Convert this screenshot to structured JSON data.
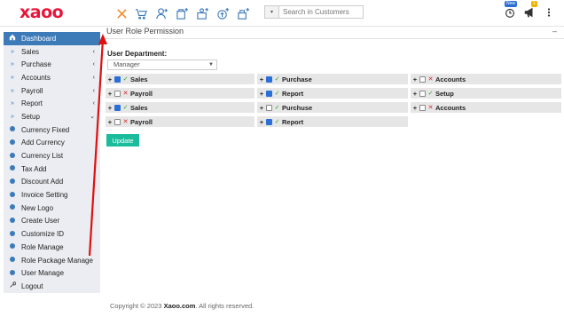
{
  "logo": "xaoo",
  "header": {
    "search_placeholder": "Search in Customers",
    "search_drop": "▾",
    "new_badge": "New",
    "notif_badge": "1"
  },
  "sidebar": {
    "items": [
      {
        "label": "Dashboard",
        "icon": "home-icon",
        "active": true,
        "chev": ""
      },
      {
        "label": "Sales",
        "icon": "double-chevron-icon",
        "chev": "‹"
      },
      {
        "label": "Purchase",
        "icon": "double-chevron-icon",
        "chev": "‹"
      },
      {
        "label": "Accounts",
        "icon": "double-chevron-icon",
        "chev": "‹"
      },
      {
        "label": "Payroll",
        "icon": "double-chevron-icon",
        "chev": "‹"
      },
      {
        "label": "Report",
        "icon": "double-chevron-icon",
        "chev": "‹"
      },
      {
        "label": "Setup",
        "icon": "double-chevron-icon",
        "chev": "⌄"
      },
      {
        "label": "Currency Fixed",
        "icon": "circle-icon",
        "chev": ""
      },
      {
        "label": "Add Currency",
        "icon": "circle-icon",
        "chev": ""
      },
      {
        "label": "Currency List",
        "icon": "circle-icon",
        "chev": ""
      },
      {
        "label": "Tax Add",
        "icon": "circle-icon",
        "chev": ""
      },
      {
        "label": "Discount Add",
        "icon": "circle-icon",
        "chev": ""
      },
      {
        "label": "Invoice Setting",
        "icon": "circle-icon",
        "chev": ""
      },
      {
        "label": "New Logo",
        "icon": "circle-icon",
        "chev": ""
      },
      {
        "label": "Create User",
        "icon": "circle-icon",
        "chev": ""
      },
      {
        "label": "Customize ID",
        "icon": "circle-icon",
        "chev": ""
      },
      {
        "label": "Role Manage",
        "icon": "circle-icon",
        "chev": ""
      },
      {
        "label": "Role Package Manage",
        "icon": "circle-icon",
        "chev": ""
      },
      {
        "label": "User Manage",
        "icon": "circle-icon",
        "chev": ""
      },
      {
        "label": "Logout",
        "icon": "wrench-icon",
        "chev": ""
      }
    ]
  },
  "main": {
    "title": "User Role Permission",
    "minimize": "–",
    "dept_label": "User Department:",
    "dept_value": "Manager",
    "update_label": "Update",
    "permissions": [
      [
        {
          "name": "Sales",
          "checked": true,
          "ok": true
        },
        {
          "name": "Purchase",
          "checked": true,
          "ok": true
        },
        {
          "name": "Accounts",
          "checked": false,
          "ok": false
        }
      ],
      [
        {
          "name": "Payroll",
          "checked": false,
          "ok": false
        },
        {
          "name": "Report",
          "checked": true,
          "ok": true
        },
        {
          "name": "Setup",
          "checked": false,
          "ok": true
        }
      ],
      [
        {
          "name": "Sales",
          "checked": true,
          "ok": true
        },
        {
          "name": "Purchuse",
          "checked": false,
          "ok": true
        },
        {
          "name": "Accounts",
          "checked": false,
          "ok": false
        }
      ],
      [
        {
          "name": "Payroll",
          "checked": false,
          "ok": false
        },
        {
          "name": "Report",
          "checked": true,
          "ok": true
        }
      ]
    ]
  },
  "footer": {
    "prefix": "Copyright © 2023 ",
    "brand": "Xaoo.com",
    "suffix": ". All rights reserved."
  },
  "colors": {
    "brand": "#e8163b",
    "accent": "#3d7ab8",
    "button": "#1abc9c",
    "arrow": "#e01010"
  }
}
